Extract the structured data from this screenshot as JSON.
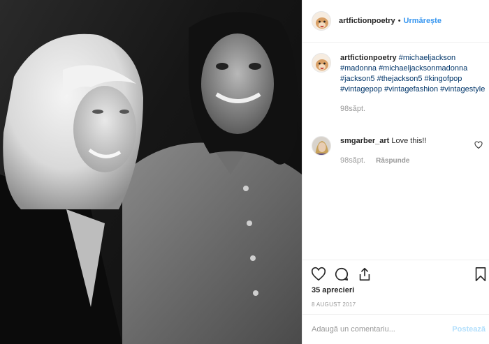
{
  "header": {
    "username": "artfictionpoetry",
    "separator": "•",
    "follow_label": "Urmărește"
  },
  "caption": {
    "username": "artfictionpoetry",
    "hashtags": [
      "#michaeljackson",
      "#madonna",
      "#michaeljacksonmadonna",
      "#jackson5",
      "#thejackson5",
      "#kingofpop",
      "#vintagepop",
      "#vintagefashion",
      "#vintagestyle"
    ],
    "time": "98săpt."
  },
  "comment": {
    "username": "smgarber_art",
    "text": "Love this!!",
    "time": "98săpt.",
    "reply_label": "Răspunde"
  },
  "actions": {
    "like_icon": "heart-icon",
    "comment_icon": "comment-icon",
    "share_icon": "share-icon",
    "save_icon": "bookmark-icon"
  },
  "likes": "35 aprecieri",
  "date": "8 AUGUST 2017",
  "add_comment": {
    "placeholder": "Adaugă un comentariu...",
    "post_label": "Postează"
  },
  "colors": {
    "link_blue": "#3897f0",
    "hashtag": "#003569",
    "muted": "#999999",
    "post_disabled": "#b2dffc"
  }
}
